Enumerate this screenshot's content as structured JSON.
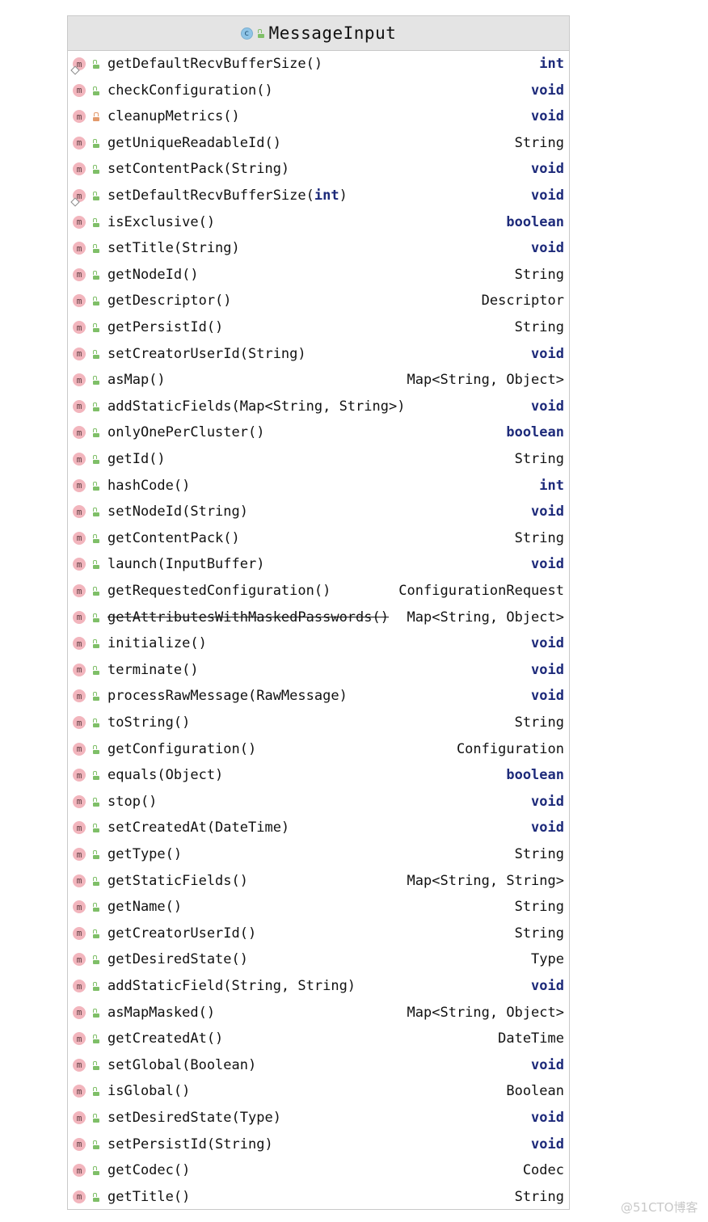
{
  "class": {
    "name": "MessageInput",
    "icon": "class-icon",
    "icon_letter": "c",
    "visibility": "public"
  },
  "methods": [
    {
      "name": "getDefaultRecvBufferSize()",
      "ret": "int",
      "ret_kw": true,
      "vis": "public",
      "override": true
    },
    {
      "name": "checkConfiguration()",
      "ret": "void",
      "ret_kw": true,
      "vis": "public"
    },
    {
      "name": "cleanupMetrics()",
      "ret": "void",
      "ret_kw": true,
      "vis": "private"
    },
    {
      "name": "getUniqueReadableId()",
      "ret": "String",
      "ret_kw": false,
      "vis": "public"
    },
    {
      "name": "setContentPack(String)",
      "ret": "void",
      "ret_kw": true,
      "vis": "public"
    },
    {
      "name": "setDefaultRecvBufferSize(int)",
      "name_prefix": "setDefaultRecvBufferSize(",
      "name_kw": "int",
      "name_suffix": ")",
      "ret": "void",
      "ret_kw": true,
      "vis": "public",
      "override": true
    },
    {
      "name": "isExclusive()",
      "ret": "boolean",
      "ret_kw": true,
      "vis": "public"
    },
    {
      "name": "setTitle(String)",
      "ret": "void",
      "ret_kw": true,
      "vis": "public"
    },
    {
      "name": "getNodeId()",
      "ret": "String",
      "ret_kw": false,
      "vis": "public"
    },
    {
      "name": "getDescriptor()",
      "ret": "Descriptor",
      "ret_kw": false,
      "vis": "public"
    },
    {
      "name": "getPersistId()",
      "ret": "String",
      "ret_kw": false,
      "vis": "public"
    },
    {
      "name": "setCreatorUserId(String)",
      "ret": "void",
      "ret_kw": true,
      "vis": "public"
    },
    {
      "name": "asMap()",
      "ret": "Map<String, Object>",
      "ret_kw": false,
      "vis": "public"
    },
    {
      "name": "addStaticFields(Map<String, String>)",
      "ret": "void",
      "ret_kw": true,
      "vis": "public"
    },
    {
      "name": "onlyOnePerCluster()",
      "ret": "boolean",
      "ret_kw": true,
      "vis": "public"
    },
    {
      "name": "getId()",
      "ret": "String",
      "ret_kw": false,
      "vis": "public"
    },
    {
      "name": "hashCode()",
      "ret": "int",
      "ret_kw": true,
      "vis": "public"
    },
    {
      "name": "setNodeId(String)",
      "ret": "void",
      "ret_kw": true,
      "vis": "public"
    },
    {
      "name": "getContentPack()",
      "ret": "String",
      "ret_kw": false,
      "vis": "public"
    },
    {
      "name": "launch(InputBuffer)",
      "ret": "void",
      "ret_kw": true,
      "vis": "public"
    },
    {
      "name": "getRequestedConfiguration()",
      "ret": "ConfigurationRequest",
      "ret_kw": false,
      "vis": "public"
    },
    {
      "name": "getAttributesWithMaskedPasswords()",
      "ret": "Map<String, Object>",
      "ret_kw": false,
      "vis": "public",
      "deprecated": true
    },
    {
      "name": "initialize()",
      "ret": "void",
      "ret_kw": true,
      "vis": "public"
    },
    {
      "name": "terminate()",
      "ret": "void",
      "ret_kw": true,
      "vis": "public"
    },
    {
      "name": "processRawMessage(RawMessage)",
      "ret": "void",
      "ret_kw": true,
      "vis": "public"
    },
    {
      "name": "toString()",
      "ret": "String",
      "ret_kw": false,
      "vis": "public"
    },
    {
      "name": "getConfiguration()",
      "ret": "Configuration",
      "ret_kw": false,
      "vis": "public"
    },
    {
      "name": "equals(Object)",
      "ret": "boolean",
      "ret_kw": true,
      "vis": "public"
    },
    {
      "name": "stop()",
      "ret": "void",
      "ret_kw": true,
      "vis": "public"
    },
    {
      "name": "setCreatedAt(DateTime)",
      "ret": "void",
      "ret_kw": true,
      "vis": "public"
    },
    {
      "name": "getType()",
      "ret": "String",
      "ret_kw": false,
      "vis": "public"
    },
    {
      "name": "getStaticFields()",
      "ret": "Map<String, String>",
      "ret_kw": false,
      "vis": "public"
    },
    {
      "name": "getName()",
      "ret": "String",
      "ret_kw": false,
      "vis": "public"
    },
    {
      "name": "getCreatorUserId()",
      "ret": "String",
      "ret_kw": false,
      "vis": "public"
    },
    {
      "name": "getDesiredState()",
      "ret": "Type",
      "ret_kw": false,
      "vis": "public"
    },
    {
      "name": "addStaticField(String, String)",
      "ret": "void",
      "ret_kw": true,
      "vis": "public"
    },
    {
      "name": "asMapMasked()",
      "ret": "Map<String, Object>",
      "ret_kw": false,
      "vis": "public"
    },
    {
      "name": "getCreatedAt()",
      "ret": "DateTime",
      "ret_kw": false,
      "vis": "public"
    },
    {
      "name": "setGlobal(Boolean)",
      "ret": "void",
      "ret_kw": true,
      "vis": "public"
    },
    {
      "name": "isGlobal()",
      "ret": "Boolean",
      "ret_kw": false,
      "vis": "public"
    },
    {
      "name": "setDesiredState(Type)",
      "ret": "void",
      "ret_kw": true,
      "vis": "public"
    },
    {
      "name": "setPersistId(String)",
      "ret": "void",
      "ret_kw": true,
      "vis": "public"
    },
    {
      "name": "getCodec()",
      "ret": "Codec",
      "ret_kw": false,
      "vis": "public"
    },
    {
      "name": "getTitle()",
      "ret": "String",
      "ret_kw": false,
      "vis": "public"
    }
  ],
  "method_icon_letter": "m",
  "watermark": "@51CTO博客"
}
